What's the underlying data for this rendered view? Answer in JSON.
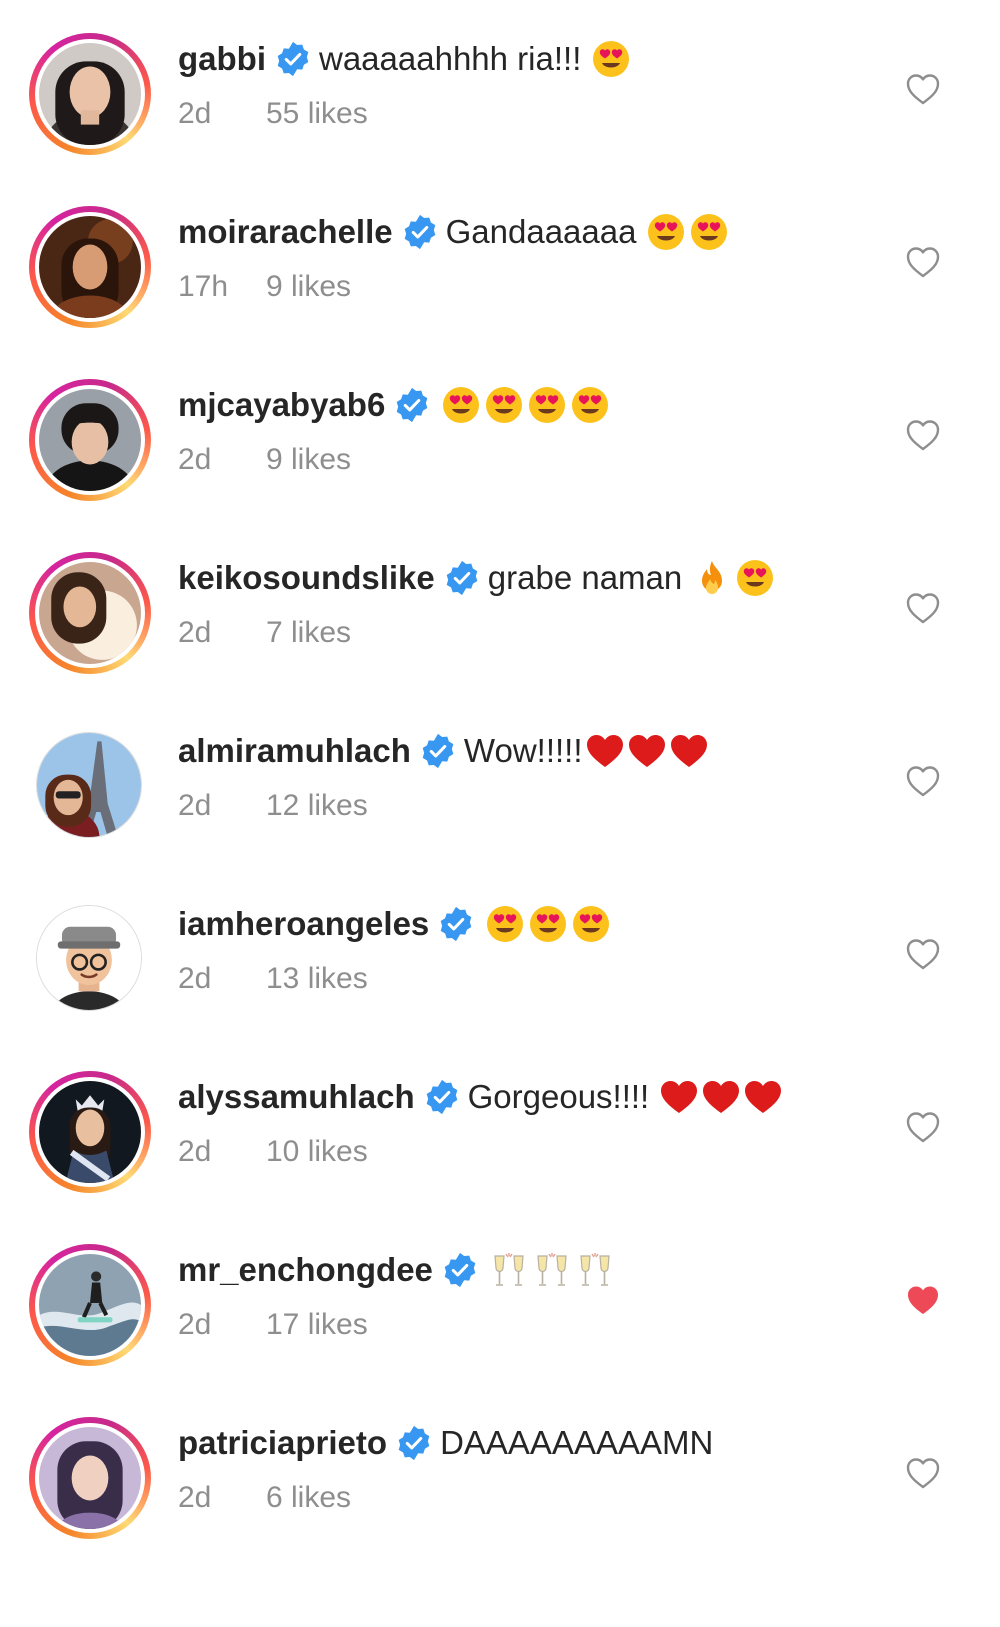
{
  "comments": [
    {
      "username": "gabbi",
      "text": "waaaaahhhh ria!!!",
      "emojis": [
        "heart-eyes"
      ],
      "time": "2d",
      "likes": "55 likes",
      "liked": false
    },
    {
      "username": "moirarachelle",
      "text": "Gandaaaaaa",
      "emojis": [
        "heart-eyes",
        "heart-eyes"
      ],
      "time": "17h",
      "likes": "9 likes",
      "liked": false
    },
    {
      "username": "mjcayabyab6",
      "text": "",
      "emojis": [
        "heart-eyes",
        "heart-eyes",
        "heart-eyes",
        "heart-eyes"
      ],
      "time": "2d",
      "likes": "9 likes",
      "liked": false
    },
    {
      "username": "keikosoundslike",
      "text": "grabe naman",
      "emojis": [
        "fire",
        "heart-eyes"
      ],
      "time": "2d",
      "likes": "7 likes",
      "liked": false
    },
    {
      "username": "almiramuhlach",
      "text": "Wow!!!!!",
      "emojis": [
        "red-heart",
        "red-heart",
        "red-heart"
      ],
      "time": "2d",
      "likes": "12 likes",
      "liked": false
    },
    {
      "username": "iamheroangeles",
      "text": "",
      "emojis": [
        "heart-eyes",
        "heart-eyes",
        "heart-eyes"
      ],
      "time": "2d",
      "likes": "13 likes",
      "liked": false
    },
    {
      "username": "alyssamuhlach",
      "text": "Gorgeous!!!!",
      "emojis": [
        "red-heart",
        "red-heart",
        "red-heart"
      ],
      "time": "2d",
      "likes": "10 likes",
      "liked": false
    },
    {
      "username": "mr_enchongdee",
      "text": "",
      "emojis": [
        "champagne-toast",
        "champagne-toast",
        "champagne-toast"
      ],
      "time": "2d",
      "likes": "17 likes",
      "liked": true
    },
    {
      "username": "patriciaprieto",
      "text": "DAAAAAAAAAMN",
      "emojis": [],
      "time": "2d",
      "likes": "6 likes",
      "liked": false
    }
  ],
  "colors": {
    "text": "#262626",
    "meta": "#8e8e8e",
    "verified": "#3897f0",
    "liked_heart": "#ed4956",
    "unliked_heart": "#8e8e8e"
  },
  "icons": {
    "verified": "verified-badge-icon",
    "like": "heart-outline-icon",
    "liked": "heart-filled-icon"
  }
}
